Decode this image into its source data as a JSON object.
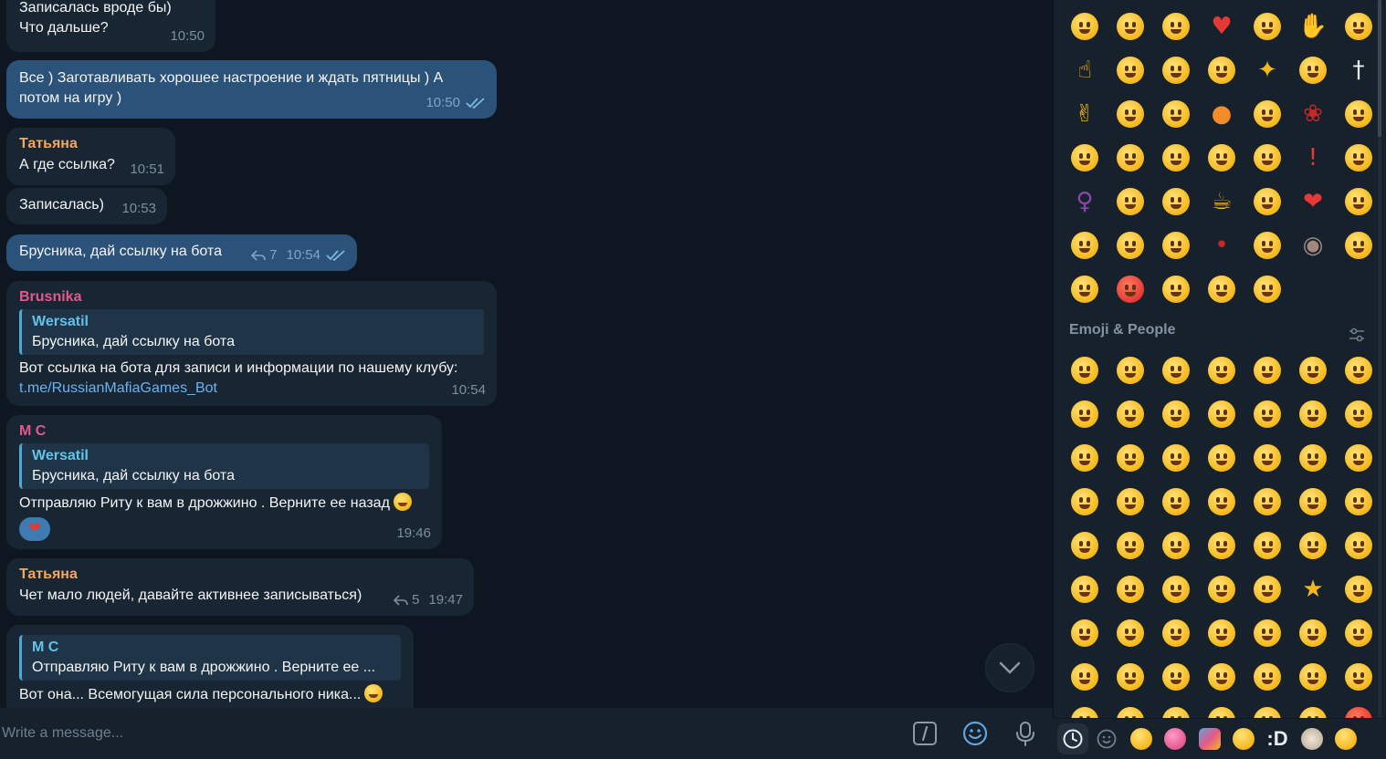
{
  "chat": {
    "messages": [
      {
        "id": "m1",
        "direction": "in",
        "text_lines": [
          "Записалась вроде бы)",
          "Что дальше?"
        ],
        "time": "10:50"
      },
      {
        "id": "m2",
        "direction": "out",
        "text": "Все ) Заготавливать хорошее настроение и ждать пятницы ) А потом на игру )",
        "time": "10:50"
      },
      {
        "id": "m3",
        "direction": "in",
        "sender": "Татьяна",
        "text": "А где ссылка?",
        "time": "10:51"
      },
      {
        "id": "m4",
        "direction": "in",
        "text": "Записалась)",
        "time": "10:53"
      },
      {
        "id": "m5",
        "direction": "out",
        "text": "Брусника, дай ссылку на бота",
        "replies": "7",
        "time": "10:54"
      },
      {
        "id": "m6",
        "direction": "in",
        "sender": "Brusnika",
        "quote_name": "Wersatil",
        "quote_text": "Брусника, дай ссылку на бота",
        "text": "Вот ссылка на бота для записи и информации по нашему клубу:",
        "link": "t.me/RussianMafiaGames_Bot",
        "time": "10:54"
      },
      {
        "id": "m7",
        "direction": "in",
        "sender": "M C",
        "quote_name": "Wersatil",
        "quote_text": "Брусника, дай ссылку на бота",
        "text": "Отправляю Риту к вам в дрожжино . Верните ее назад",
        "time": "19:46"
      },
      {
        "id": "m8",
        "direction": "in",
        "sender": "Татьяна",
        "text": "Чет мало людей, давайте активнее записываться)",
        "replies": "5",
        "time": "19:47"
      },
      {
        "id": "m9",
        "direction": "in",
        "quote_name": "M C",
        "quote_text": "Отправляю Риту к вам в дрожжино . Верните ее ...",
        "text": "Вот она... Всемогущая сила персонального ника..."
      }
    ]
  },
  "composer": {
    "placeholder": "Write a message...",
    "icons": [
      "commands-icon",
      "emoji-icon",
      "microphone-icon"
    ]
  },
  "emoji_panel": {
    "section_title": "Emoji & People",
    "recent_count": 47,
    "people_count": 63,
    "tab_text": ":D"
  },
  "colors": {
    "bg": "#0e1621",
    "incoming": "#182533",
    "outgoing": "#2b5278",
    "accent": "#6ab3f3",
    "sender_tatyana": "#f3a65e",
    "sender_brusnika": "#e3588d",
    "sender_mc": "#e3588d"
  }
}
